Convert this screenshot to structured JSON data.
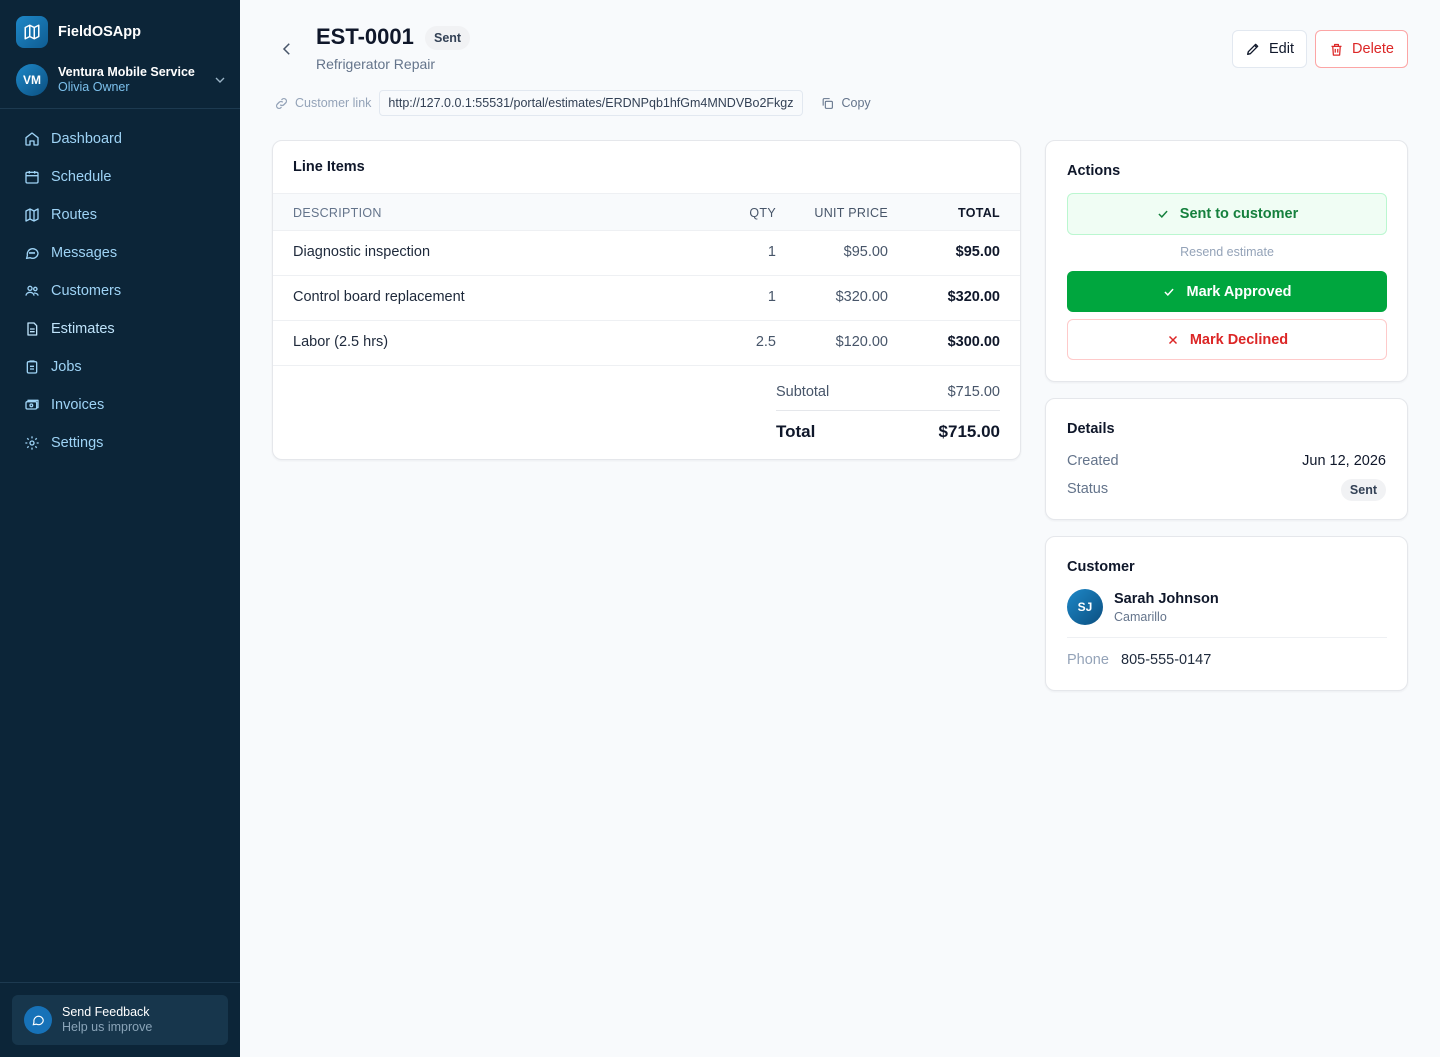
{
  "app": {
    "name": "FieldOSApp"
  },
  "org": {
    "initials": "VM",
    "name": "Ventura Mobile Service",
    "user": "Olivia Owner"
  },
  "nav": [
    {
      "label": "Dashboard",
      "icon": "home-icon"
    },
    {
      "label": "Schedule",
      "icon": "calendar-icon"
    },
    {
      "label": "Routes",
      "icon": "map-icon"
    },
    {
      "label": "Messages",
      "icon": "message-icon"
    },
    {
      "label": "Customers",
      "icon": "users-icon"
    },
    {
      "label": "Estimates",
      "icon": "document-icon"
    },
    {
      "label": "Jobs",
      "icon": "clipboard-icon"
    },
    {
      "label": "Invoices",
      "icon": "invoice-icon"
    },
    {
      "label": "Settings",
      "icon": "gear-icon"
    }
  ],
  "feedback": {
    "title": "Send Feedback",
    "subtitle": "Help us improve"
  },
  "estimate": {
    "number": "EST-0001",
    "status": "Sent",
    "title": "Refrigerator Repair"
  },
  "header_actions": {
    "edit": "Edit",
    "delete": "Delete"
  },
  "customer_link": {
    "label": "Customer link",
    "url": "http://127.0.0.1:55531/portal/estimates/ERDNPqb1hfGm4MNDVBo2Fkgz",
    "copy": "Copy"
  },
  "line_items": {
    "title": "Line Items",
    "columns": {
      "description": "DESCRIPTION",
      "qty": "QTY",
      "unit_price": "UNIT PRICE",
      "total": "TOTAL"
    },
    "rows": [
      {
        "description": "Diagnostic inspection",
        "qty": "1",
        "unit_price": "$95.00",
        "total": "$95.00"
      },
      {
        "description": "Control board replacement",
        "qty": "1",
        "unit_price": "$320.00",
        "total": "$320.00"
      },
      {
        "description": "Labor (2.5 hrs)",
        "qty": "2.5",
        "unit_price": "$120.00",
        "total": "$300.00"
      }
    ],
    "subtotal_label": "Subtotal",
    "subtotal": "$715.00",
    "total_label": "Total",
    "total": "$715.00"
  },
  "actions": {
    "title": "Actions",
    "sent_label": "Sent to customer",
    "resend": "Resend estimate",
    "approve": "Mark Approved",
    "decline": "Mark Declined"
  },
  "details": {
    "title": "Details",
    "created_label": "Created",
    "created": "Jun 12, 2026",
    "status_label": "Status",
    "status": "Sent"
  },
  "customer": {
    "title": "Customer",
    "initials": "SJ",
    "name": "Sarah Johnson",
    "city": "Camarillo",
    "phone_label": "Phone",
    "phone": "805-555-0147"
  },
  "colors": {
    "sidebar": "#0c2538",
    "nav_text": "#9ed3f5",
    "approve": "#00a63e",
    "danger": "#dc2626",
    "success_text": "#15803d"
  }
}
